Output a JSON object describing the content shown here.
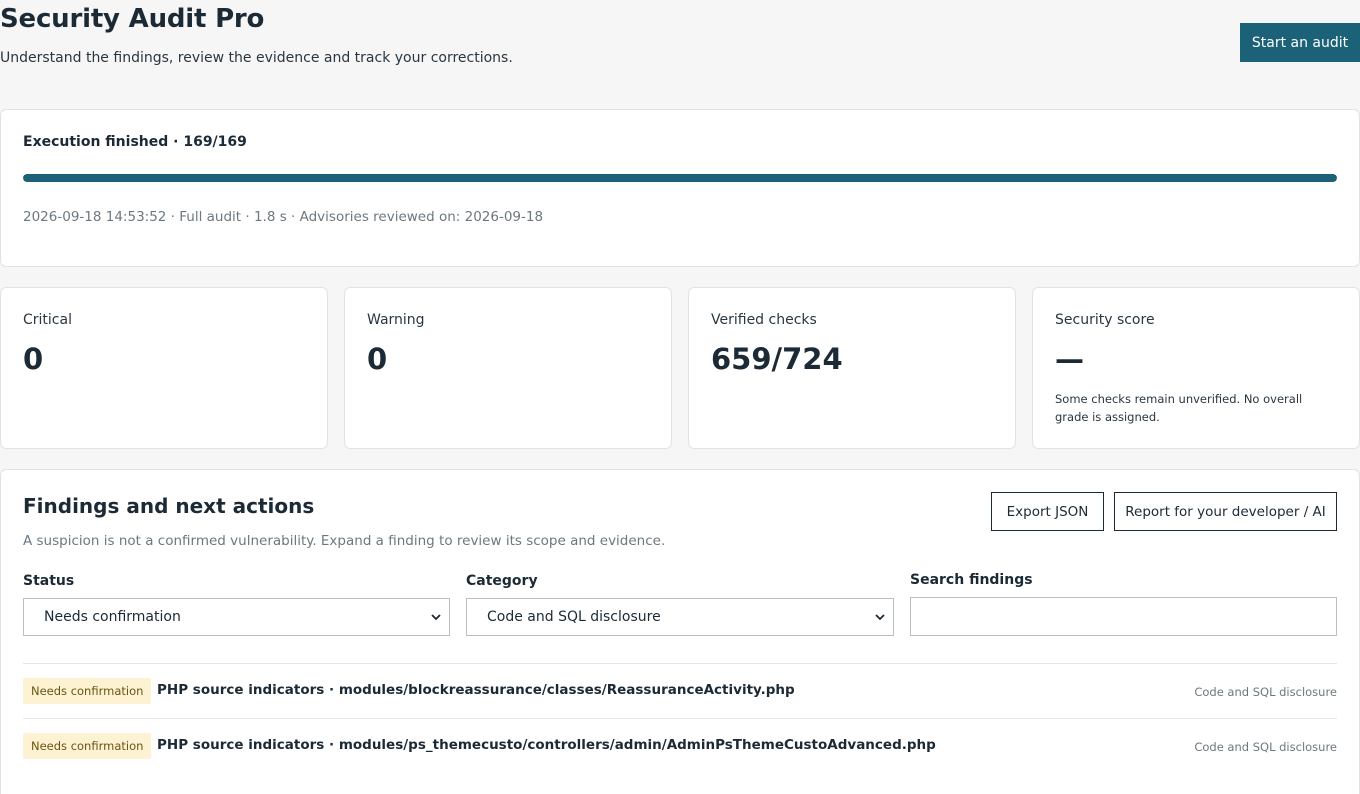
{
  "header": {
    "title": "Security Audit Pro",
    "subtitle": "Understand the findings, review the evidence and track your corrections.",
    "start_button": "Start an audit"
  },
  "execution": {
    "title": "Execution finished · 169/169",
    "progress_percent": 100,
    "meta": "2026-09-18 14:53:52 · Full audit · 1.8 s · Advisories reviewed on: 2026-09-18"
  },
  "stats": {
    "critical": {
      "label": "Critical",
      "value": "0"
    },
    "warning": {
      "label": "Warning",
      "value": "0"
    },
    "verified": {
      "label": "Verified checks",
      "value": "659/724"
    },
    "score": {
      "label": "Security score",
      "value": "—",
      "note": "Some checks remain unverified. No overall grade is assigned."
    }
  },
  "findings": {
    "title": "Findings and next actions",
    "description": "A suspicion is not a confirmed vulnerability. Expand a finding to review its scope and evidence.",
    "export_button": "Export JSON",
    "report_button": "Report for your developer / AI",
    "filters": {
      "status_label": "Status",
      "status_value": "Needs confirmation",
      "category_label": "Category",
      "category_value": "Code and SQL disclosure",
      "search_label": "Search findings",
      "search_value": ""
    },
    "items": [
      {
        "badge": "Needs confirmation",
        "title": "PHP source indicators · modules/blockreassurance/classes/ReassuranceActivity.php",
        "category": "Code and SQL disclosure"
      },
      {
        "badge": "Needs confirmation",
        "title": "PHP source indicators · modules/ps_themecusto/controllers/admin/AdminPsThemeCustoAdvanced.php",
        "category": "Code and SQL disclosure"
      }
    ]
  },
  "colors": {
    "accent": "#1b6177",
    "badge_bg": "#fdf3d3",
    "badge_text": "#6b5310"
  }
}
